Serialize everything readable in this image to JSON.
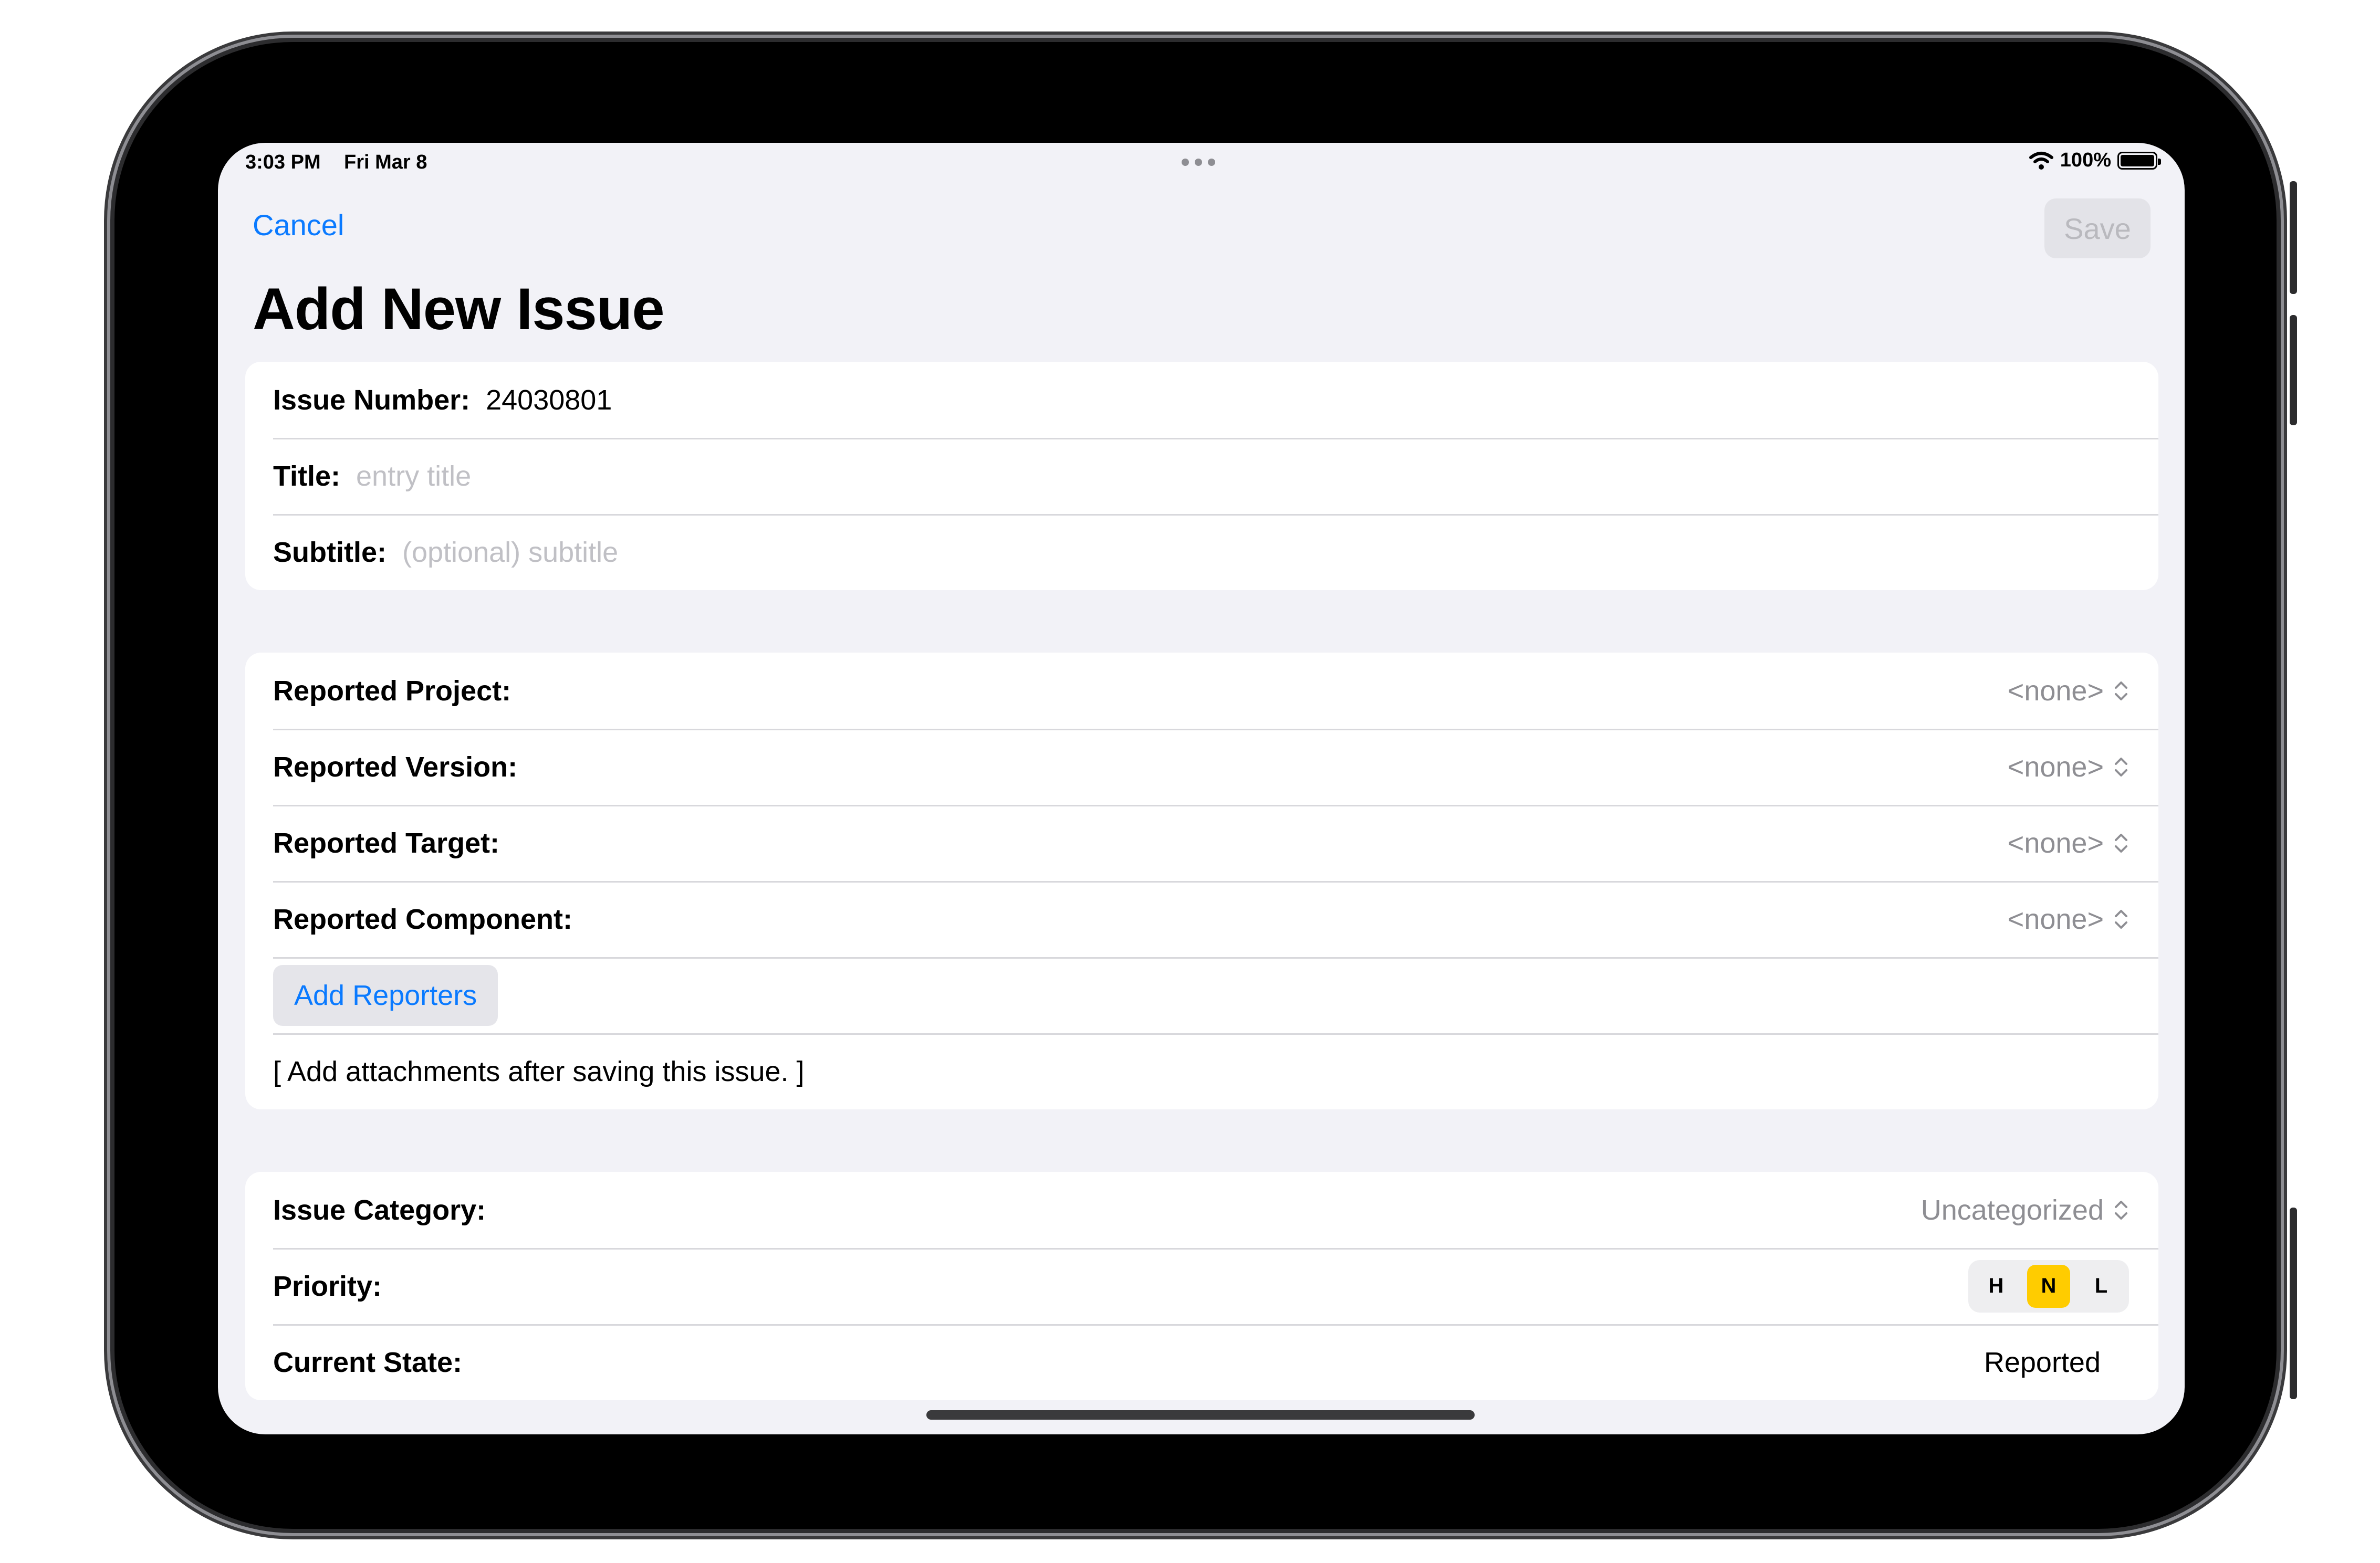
{
  "status_bar": {
    "time": "3:03 PM",
    "date": "Fri Mar 8",
    "battery": "100%"
  },
  "nav": {
    "cancel_label": "Cancel",
    "save_label": "Save"
  },
  "page_title": "Add New Issue",
  "basic": {
    "issue_number_label": "Issue Number:",
    "issue_number_value": "24030801",
    "title_label": "Title:",
    "title_placeholder": "entry title",
    "subtitle_label": "Subtitle:",
    "subtitle_placeholder": "(optional) subtitle"
  },
  "report": {
    "project_label": "Reported Project:",
    "project_value": "<none>",
    "version_label": "Reported Version:",
    "version_value": "<none>",
    "target_label": "Reported Target:",
    "target_value": "<none>",
    "component_label": "Reported Component:",
    "component_value": "<none>",
    "add_reporters_label": "Add Reporters",
    "attachments_note": "[ Add attachments after saving this issue. ]"
  },
  "classification": {
    "category_label": "Issue Category:",
    "category_value": "Uncategorized",
    "priority_label": "Priority:",
    "priority_options": [
      "H",
      "N",
      "L"
    ],
    "priority_selected": "N",
    "state_label": "Current State:",
    "state_value": "Reported"
  },
  "colors": {
    "accent": "#0a7aff",
    "priority_selected": "#ffcc00",
    "background": "#f2f2f7"
  }
}
